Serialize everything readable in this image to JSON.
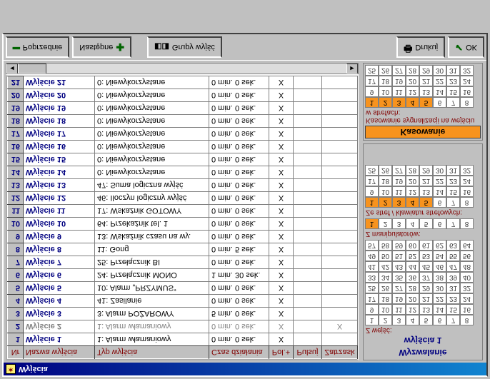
{
  "window": {
    "title": "Wyjścia"
  },
  "columns": {
    "nr": "Nr",
    "name": "Nazwa wyjścia",
    "type": "Typ wyjścia",
    "time": "Czas działania",
    "pol": "Pol.+",
    "puls": "Pulsuj",
    "latch": "Zatrzask"
  },
  "rows": [
    {
      "nr": "1",
      "name": "Wyjście 1",
      "type": "1: Alarm włamaniowy",
      "time": "0 min. 0 sek.",
      "pol": "X",
      "puls": "",
      "latch": "",
      "gray": false
    },
    {
      "nr": "2",
      "name": "Wyjście 2",
      "type": "1: Alarm włamaniowy",
      "time": "0 min. 0 sek.",
      "pol": "X",
      "puls": "",
      "latch": "X",
      "gray": true
    },
    {
      "nr": "3",
      "name": "Wyjście 3",
      "type": "3: Alarm POŻAROWY",
      "time": "5 min. 0 sek.",
      "pol": "X",
      "puls": "",
      "latch": "",
      "gray": false
    },
    {
      "nr": "4",
      "name": "Wyjście 4",
      "type": "41: Zasilanie",
      "time": "0 min. 0 sek.",
      "pol": "X",
      "puls": "",
      "latch": "",
      "gray": false
    },
    {
      "nr": "5",
      "name": "Wyjście 5",
      "type": "10: Alarm „PRZYMUS”",
      "time": "0 min. 0 sek.",
      "pol": "X",
      "puls": "",
      "latch": "",
      "gray": false
    },
    {
      "nr": "6",
      "name": "Wyjście 6",
      "type": "24: Przełącznik MONO",
      "time": "1 min. 30 sek.",
      "pol": "X",
      "puls": "",
      "latch": "",
      "gray": false
    },
    {
      "nr": "7",
      "name": "Wyjście 7",
      "type": "25: Przełącznik BI",
      "time": "0 min. 0 sek.",
      "pol": "X",
      "puls": "",
      "latch": "",
      "gray": false
    },
    {
      "nr": "8",
      "name": "Wyjście 8",
      "type": "11: Gong",
      "time": "0 min. 5 sek.",
      "pol": "X",
      "puls": "",
      "latch": "",
      "gray": false
    },
    {
      "nr": "9",
      "name": "Wyjście 9",
      "type": "13: Wskaźnik czasu na wy.",
      "time": "0 min. 0 sek.",
      "pol": "X",
      "puls": "",
      "latch": "",
      "gray": false
    },
    {
      "nr": "10",
      "name": "Wyjście 10",
      "type": "64: Przekaźnik tel. 1",
      "time": "0 min. 0 sek.",
      "pol": "X",
      "puls": "",
      "latch": "",
      "gray": false
    },
    {
      "nr": "11",
      "name": "Wyjście 11",
      "type": "17: Wskaźnik GOTOWY",
      "time": "0 min. 0 sek.",
      "pol": "X",
      "puls": "",
      "latch": "",
      "gray": false
    },
    {
      "nr": "12",
      "name": "Wyjście 12",
      "type": "46: Iloczyn logiczny wyjść",
      "time": "0 min. 0 sek.",
      "pol": "X",
      "puls": "",
      "latch": "",
      "gray": false
    },
    {
      "nr": "13",
      "name": "Wyjście 13",
      "type": "47: Suma logiczna wyjść",
      "time": "0 min. 0 sek.",
      "pol": "X",
      "puls": "",
      "latch": "",
      "gray": false
    },
    {
      "nr": "14",
      "name": "Wyjście 14",
      "type": "0: Niewykorzystane",
      "time": "0 min. 0 sek.",
      "pol": "X",
      "puls": "",
      "latch": "",
      "gray": false
    },
    {
      "nr": "15",
      "name": "Wyjście 15",
      "type": "0: Niewykorzystane",
      "time": "0 min. 0 sek.",
      "pol": "X",
      "puls": "",
      "latch": "",
      "gray": false
    },
    {
      "nr": "16",
      "name": "Wyjście 16",
      "type": "0: Niewykorzystane",
      "time": "0 min. 0 sek.",
      "pol": "X",
      "puls": "",
      "latch": "",
      "gray": false
    },
    {
      "nr": "17",
      "name": "Wyjście 17",
      "type": "0: Niewykorzystane",
      "time": "0 min. 0 sek.",
      "pol": "X",
      "puls": "",
      "latch": "",
      "gray": false
    },
    {
      "nr": "18",
      "name": "Wyjście 18",
      "type": "0: Niewykorzystane",
      "time": "0 min. 0 sek.",
      "pol": "X",
      "puls": "",
      "latch": "",
      "gray": false
    },
    {
      "nr": "19",
      "name": "Wyjście 19",
      "type": "0: Niewykorzystane",
      "time": "0 min. 0 sek.",
      "pol": "X",
      "puls": "",
      "latch": "",
      "gray": false
    },
    {
      "nr": "20",
      "name": "Wyjście 20",
      "type": "0: Niewykorzystane",
      "time": "0 min. 0 sek.",
      "pol": "X",
      "puls": "",
      "latch": "",
      "gray": false
    },
    {
      "nr": "21",
      "name": "Wyjście 21",
      "type": "0: Niewykorzystane",
      "time": "0 min. 0 sek.",
      "pol": "X",
      "puls": "",
      "latch": "",
      "gray": false
    }
  ],
  "right": {
    "wyzwalanie_title": "Wyzwalanie",
    "wyjscia_title": "wyjścia 1",
    "z_wejsc": "Z wejść:",
    "z_manip": "Z manipulatorów:",
    "ze_stref": "Ze stref / klawiatur strefowych:",
    "kasowanie_hdr": "Kasowanie",
    "kasowanie_sub": "Kasowanie sygnalizacji na wejściu w strefach:",
    "grid64": [
      1,
      2,
      3,
      4,
      5,
      6,
      7,
      8,
      9,
      10,
      11,
      12,
      13,
      14,
      15,
      16,
      17,
      18,
      19,
      20,
      21,
      22,
      23,
      24,
      25,
      26,
      27,
      28,
      29,
      30,
      31,
      32,
      33,
      34,
      35,
      36,
      37,
      38,
      39,
      40,
      41,
      42,
      43,
      44,
      45,
      46,
      47,
      48,
      49,
      50,
      51,
      52,
      53,
      54,
      55,
      56,
      57,
      58,
      59,
      60,
      61,
      62,
      63,
      64
    ],
    "grid8": [
      1,
      2,
      3,
      4,
      5,
      6,
      7,
      8
    ],
    "grid32": [
      1,
      2,
      3,
      4,
      5,
      6,
      7,
      8,
      9,
      10,
      11,
      12,
      13,
      14,
      15,
      16,
      17,
      18,
      19,
      20,
      21,
      22,
      23,
      24,
      25,
      26,
      27,
      28,
      29,
      30,
      31,
      32
    ],
    "sel_manip": 1,
    "sel_stref_hi": [
      1,
      2,
      3,
      4,
      5
    ],
    "sel_kas_hi": [
      1,
      2,
      3,
      4,
      5
    ]
  },
  "buttons": {
    "prev": "Poprzednie",
    "next": "Następne",
    "groups": "Grupy wyjść",
    "print": "Drukuj",
    "ok": "OK"
  }
}
